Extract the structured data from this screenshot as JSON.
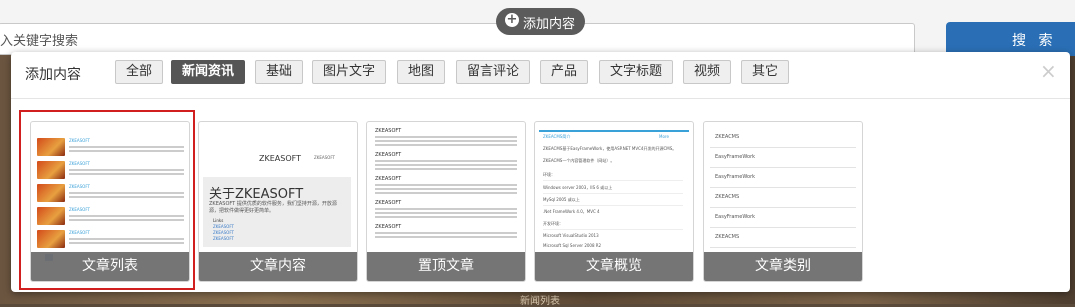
{
  "page": {
    "add_button_label": "添加内容",
    "search_placeholder": "入关键字搜索",
    "search_button": "搜 索",
    "bottom_hint": "新闻列表"
  },
  "modal": {
    "title": "添加内容",
    "close_symbol": "×",
    "tabs": [
      "全部",
      "新闻资讯",
      "基础",
      "图片文字",
      "地图",
      "留言评论",
      "产品",
      "文字标题",
      "视频",
      "其它"
    ],
    "active_tab": "新闻资讯",
    "cards": [
      {
        "caption": "文章列表",
        "selected": true
      },
      {
        "caption": "文章内容",
        "selected": false
      },
      {
        "caption": "置顶文章",
        "selected": false
      },
      {
        "caption": "文章概览",
        "selected": false
      },
      {
        "caption": "文章类别",
        "selected": false
      }
    ]
  },
  "previews": {
    "list_item_title": "ZKEASOFT",
    "content_logo": "ZKEASOFT",
    "content_heading": "关于ZKEASOFT",
    "content_text": "ZKEASOFT 提供优质的软件服务，我们坚持开源，开放源源，把软件做得更好更简单。",
    "content_links_head": "Links",
    "content_links": [
      "ZKEASOFT",
      "ZKEASOFT",
      "ZKEASOFT",
      "ZKEASOFT"
    ],
    "content_menu": "ZKEASOFT",
    "top_article_title": "ZKEASOFT",
    "overview_title": "ZKEACMS简介",
    "overview_more": "More",
    "overview_lines": [
      "ZKEACMS基于EasyFrameWork，使用ASP.NET MVC4开发的开源CMS。",
      "ZKEACMS一个内容管理软件（网站）。",
      "环境：",
      "Windows server 2003，IIS 6 或以上",
      "MySql 2005 或以上",
      ".Net FrameWork 4.0，MVC 4",
      "开发环境：",
      "Microsoft VisualStudio 2013",
      "Microsoft Sql Server 2008 R2"
    ],
    "category_items": [
      "ZKEACMS",
      "EasyFrameWork",
      "EasyFrameWork",
      "ZKEACMS",
      "EasyFrameWork",
      "ZKEACMS"
    ]
  }
}
